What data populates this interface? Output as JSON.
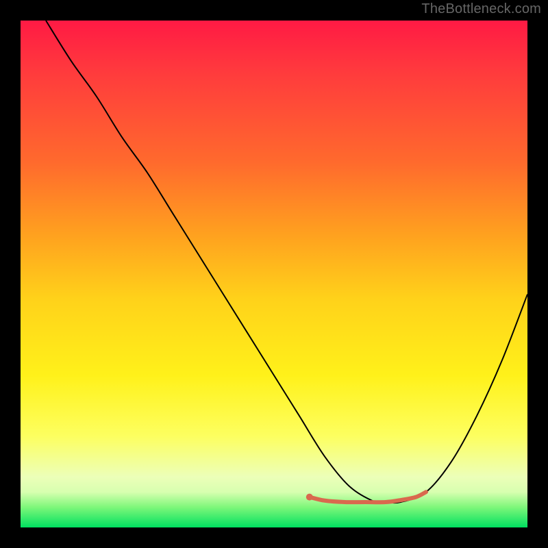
{
  "watermark": "TheBottleneck.com",
  "chart_data": {
    "type": "line",
    "title": "",
    "xlabel": "",
    "ylabel": "",
    "xlim": [
      0,
      100
    ],
    "ylim": [
      0,
      100
    ],
    "grid": false,
    "legend": false,
    "gradient_stops": [
      {
        "pos": 0,
        "color": "#ff1a44"
      },
      {
        "pos": 10,
        "color": "#ff3a3d"
      },
      {
        "pos": 28,
        "color": "#ff6a2d"
      },
      {
        "pos": 42,
        "color": "#ffa01f"
      },
      {
        "pos": 55,
        "color": "#ffd21a"
      },
      {
        "pos": 70,
        "color": "#fff11a"
      },
      {
        "pos": 82,
        "color": "#fdff60"
      },
      {
        "pos": 90,
        "color": "#ecffb8"
      },
      {
        "pos": 93,
        "color": "#d8ffb0"
      },
      {
        "pos": 96,
        "color": "#7ef77a"
      },
      {
        "pos": 100,
        "color": "#00e060"
      }
    ],
    "series": [
      {
        "name": "bottleneck-curve",
        "color": "#000000",
        "stroke_width": 2,
        "x": [
          5,
          10,
          15,
          20,
          25,
          30,
          35,
          40,
          45,
          50,
          55,
          60,
          65,
          70,
          72,
          75,
          80,
          85,
          90,
          95,
          100
        ],
        "y": [
          100,
          92,
          85,
          77,
          70,
          62,
          54,
          46,
          38,
          30,
          22,
          14,
          8,
          5,
          5,
          5,
          7,
          13,
          22,
          33,
          46
        ]
      },
      {
        "name": "optimal-zone-marker",
        "color": "#d9694e",
        "stroke_width": 6,
        "marker_start_dot": true,
        "x": [
          57,
          60,
          64,
          68,
          72,
          75,
          78,
          80
        ],
        "y": [
          6,
          5.3,
          5,
          5,
          5,
          5.4,
          6,
          7
        ]
      }
    ],
    "optimal_range_x": [
      57,
      80
    ]
  }
}
